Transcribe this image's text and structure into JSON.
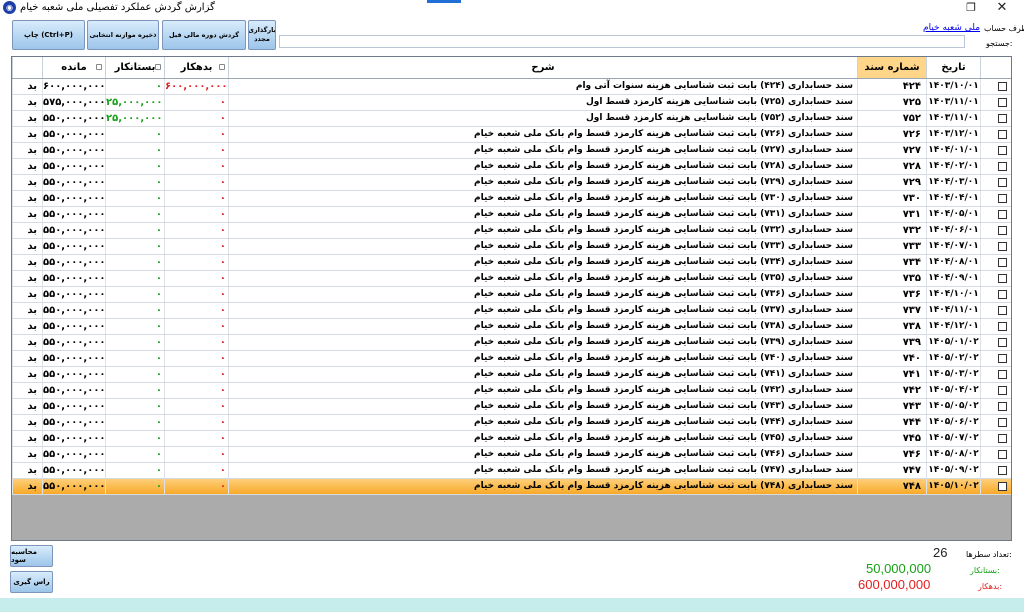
{
  "window": {
    "title": "گزارش گردش عملکرد تفصیلی  ملی شعبه خیام",
    "icon": "app-logo-icon",
    "restore_glyph": "❐",
    "close_glyph": "✕"
  },
  "toolbar": {
    "print_label": "چاپ (Ctrl+P)",
    "save_balance_label": "ذخیره موازنه انتخابی",
    "prev_turnover_label": "گردش دوره مالی قبل",
    "reload_label": "بارگذاری مجدد",
    "account_label": "طرف حساب:",
    "account_link": "ملی شعبه خیام",
    "search_label": "جستجو:",
    "search_value": "",
    "search_placeholder": ""
  },
  "grid": {
    "columns": {
      "date": "تاریخ",
      "doc_no": "شماره سند",
      "description": "شرح",
      "debit": "بدهکار",
      "credit": "بستانکار",
      "balance": "مانده"
    },
    "rows": [
      {
        "date": "۱۴۰۳/۱۰/۰۱",
        "doc_no": "۴۲۴",
        "description": "سند حسابداری (۴۲۴) بابت ثبت شناسایی هزینه سنوات آتی وام",
        "debit": "۶۰۰,۰۰۰,۰۰۰",
        "credit": "۰",
        "balance": "۶۰۰,۰۰۰,۰۰۰",
        "status": "بد"
      },
      {
        "date": "۱۴۰۳/۱۱/۰۱",
        "doc_no": "۷۲۵",
        "description": "سند حسابداری (۷۲۵) بابت شناسایی هزینه کارمزد قسط اول",
        "debit": "۰",
        "credit": "۲۵,۰۰۰,۰۰۰",
        "balance": "۵۷۵,۰۰۰,۰۰۰",
        "status": "بد"
      },
      {
        "date": "۱۴۰۳/۱۱/۰۱",
        "doc_no": "۷۵۲",
        "description": "سند حسابداری (۷۵۲) بابت شناسایی هزینه کارمزد قسط اول",
        "debit": "۰",
        "credit": "۲۵,۰۰۰,۰۰۰",
        "balance": "۵۵۰,۰۰۰,۰۰۰",
        "status": "بد"
      },
      {
        "date": "۱۴۰۳/۱۲/۰۱",
        "doc_no": "۷۲۶",
        "description": "سند حسابداری (۷۲۶) بابت ثبت شناسایی هزینه کارمزد قسط وام بانک ملی شعبه خیام",
        "debit": "۰",
        "credit": "۰",
        "balance": "۵۵۰,۰۰۰,۰۰۰",
        "status": "بد"
      },
      {
        "date": "۱۴۰۴/۰۱/۰۱",
        "doc_no": "۷۲۷",
        "description": "سند حسابداری (۷۲۷) بابت ثبت شناسایی هزینه کارمزد قسط وام بانک ملی شعبه خیام",
        "debit": "۰",
        "credit": "۰",
        "balance": "۵۵۰,۰۰۰,۰۰۰",
        "status": "بد"
      },
      {
        "date": "۱۴۰۴/۰۲/۰۱",
        "doc_no": "۷۲۸",
        "description": "سند حسابداری (۷۲۸) بابت ثبت شناسایی هزینه کارمزد قسط وام بانک ملی شعبه خیام",
        "debit": "۰",
        "credit": "۰",
        "balance": "۵۵۰,۰۰۰,۰۰۰",
        "status": "بد"
      },
      {
        "date": "۱۴۰۴/۰۳/۰۱",
        "doc_no": "۷۲۹",
        "description": "سند حسابداری (۷۲۹) بابت ثبت شناسایی هزینه کارمزد قسط وام بانک ملی شعبه خیام",
        "debit": "۰",
        "credit": "۰",
        "balance": "۵۵۰,۰۰۰,۰۰۰",
        "status": "بد"
      },
      {
        "date": "۱۴۰۴/۰۴/۰۱",
        "doc_no": "۷۳۰",
        "description": "سند حسابداری (۷۳۰) بابت ثبت شناسایی هزینه کارمزد قسط وام بانک ملی شعبه خیام",
        "debit": "۰",
        "credit": "۰",
        "balance": "۵۵۰,۰۰۰,۰۰۰",
        "status": "بد"
      },
      {
        "date": "۱۴۰۴/۰۵/۰۱",
        "doc_no": "۷۳۱",
        "description": "سند حسابداری (۷۳۱) بابت ثبت شناسایی هزینه کارمزد قسط وام بانک ملی شعبه خیام",
        "debit": "۰",
        "credit": "۰",
        "balance": "۵۵۰,۰۰۰,۰۰۰",
        "status": "بد"
      },
      {
        "date": "۱۴۰۴/۰۶/۰۱",
        "doc_no": "۷۳۲",
        "description": "سند حسابداری (۷۳۲) بابت ثبت شناسایی هزینه کارمزد قسط وام بانک ملی شعبه خیام",
        "debit": "۰",
        "credit": "۰",
        "balance": "۵۵۰,۰۰۰,۰۰۰",
        "status": "بد"
      },
      {
        "date": "۱۴۰۴/۰۷/۰۱",
        "doc_no": "۷۳۳",
        "description": "سند حسابداری (۷۳۳) بابت ثبت شناسایی هزینه کارمزد قسط وام بانک ملی شعبه خیام",
        "debit": "۰",
        "credit": "۰",
        "balance": "۵۵۰,۰۰۰,۰۰۰",
        "status": "بد"
      },
      {
        "date": "۱۴۰۴/۰۸/۰۱",
        "doc_no": "۷۳۴",
        "description": "سند حسابداری (۷۳۴) بابت ثبت شناسایی هزینه کارمزد قسط وام بانک ملی شعبه خیام",
        "debit": "۰",
        "credit": "۰",
        "balance": "۵۵۰,۰۰۰,۰۰۰",
        "status": "بد"
      },
      {
        "date": "۱۴۰۴/۰۹/۰۱",
        "doc_no": "۷۳۵",
        "description": "سند حسابداری (۷۳۵) بابت ثبت شناسایی هزینه کارمزد قسط وام بانک ملی شعبه خیام",
        "debit": "۰",
        "credit": "۰",
        "balance": "۵۵۰,۰۰۰,۰۰۰",
        "status": "بد"
      },
      {
        "date": "۱۴۰۴/۱۰/۰۱",
        "doc_no": "۷۳۶",
        "description": "سند حسابداری (۷۳۶) بابت ثبت شناسایی هزینه کارمزد قسط وام بانک ملی شعبه خیام",
        "debit": "۰",
        "credit": "۰",
        "balance": "۵۵۰,۰۰۰,۰۰۰",
        "status": "بد"
      },
      {
        "date": "۱۴۰۴/۱۱/۰۱",
        "doc_no": "۷۳۷",
        "description": "سند حسابداری (۷۳۷) بابت ثبت شناسایی هزینه کارمزد قسط وام بانک ملی شعبه خیام",
        "debit": "۰",
        "credit": "۰",
        "balance": "۵۵۰,۰۰۰,۰۰۰",
        "status": "بد"
      },
      {
        "date": "۱۴۰۴/۱۲/۰۱",
        "doc_no": "۷۳۸",
        "description": "سند حسابداری (۷۳۸) بابت ثبت شناسایی هزینه کارمزد قسط وام بانک ملی شعبه خیام",
        "debit": "۰",
        "credit": "۰",
        "balance": "۵۵۰,۰۰۰,۰۰۰",
        "status": "بد"
      },
      {
        "date": "۱۴۰۵/۰۱/۰۲",
        "doc_no": "۷۳۹",
        "description": "سند حسابداری (۷۳۹) بابت ثبت شناسایی هزینه کارمزد قسط وام بانک ملی شعبه خیام",
        "debit": "۰",
        "credit": "۰",
        "balance": "۵۵۰,۰۰۰,۰۰۰",
        "status": "بد"
      },
      {
        "date": "۱۴۰۵/۰۲/۰۲",
        "doc_no": "۷۴۰",
        "description": "سند حسابداری (۷۴۰) بابت ثبت شناسایی هزینه کارمزد قسط وام بانک ملی شعبه خیام",
        "debit": "۰",
        "credit": "۰",
        "balance": "۵۵۰,۰۰۰,۰۰۰",
        "status": "بد"
      },
      {
        "date": "۱۴۰۵/۰۳/۰۲",
        "doc_no": "۷۴۱",
        "description": "سند حسابداری (۷۴۱) بابت ثبت شناسایی هزینه کارمزد قسط وام بانک ملی شعبه خیام",
        "debit": "۰",
        "credit": "۰",
        "balance": "۵۵۰,۰۰۰,۰۰۰",
        "status": "بد"
      },
      {
        "date": "۱۴۰۵/۰۴/۰۲",
        "doc_no": "۷۴۲",
        "description": "سند حسابداری (۷۴۲) بابت ثبت شناسایی هزینه کارمزد قسط وام بانک ملی شعبه خیام",
        "debit": "۰",
        "credit": "۰",
        "balance": "۵۵۰,۰۰۰,۰۰۰",
        "status": "بد"
      },
      {
        "date": "۱۴۰۵/۰۵/۰۲",
        "doc_no": "۷۴۳",
        "description": "سند حسابداری (۷۴۳) بابت ثبت شناسایی هزینه کارمزد قسط وام بانک ملی شعبه خیام",
        "debit": "۰",
        "credit": "۰",
        "balance": "۵۵۰,۰۰۰,۰۰۰",
        "status": "بد"
      },
      {
        "date": "۱۴۰۵/۰۶/۰۲",
        "doc_no": "۷۴۴",
        "description": "سند حسابداری (۷۴۴) بابت ثبت شناسایی هزینه کارمزد قسط وام بانک ملی شعبه خیام",
        "debit": "۰",
        "credit": "۰",
        "balance": "۵۵۰,۰۰۰,۰۰۰",
        "status": "بد"
      },
      {
        "date": "۱۴۰۵/۰۷/۰۲",
        "doc_no": "۷۴۵",
        "description": "سند حسابداری (۷۴۵) بابت ثبت شناسایی هزینه کارمزد قسط وام بانک ملی شعبه خیام",
        "debit": "۰",
        "credit": "۰",
        "balance": "۵۵۰,۰۰۰,۰۰۰",
        "status": "بد"
      },
      {
        "date": "۱۴۰۵/۰۸/۰۲",
        "doc_no": "۷۴۶",
        "description": "سند حسابداری (۷۴۶) بابت ثبت شناسایی هزینه کارمزد قسط وام بانک ملی شعبه خیام",
        "debit": "۰",
        "credit": "۰",
        "balance": "۵۵۰,۰۰۰,۰۰۰",
        "status": "بد"
      },
      {
        "date": "۱۴۰۵/۰۹/۰۲",
        "doc_no": "۷۴۷",
        "description": "سند حسابداری (۷۴۷) بابت ثبت شناسایی هزینه کارمزد قسط وام بانک ملی شعبه خیام",
        "debit": "۰",
        "credit": "۰",
        "balance": "۵۵۰,۰۰۰,۰۰۰",
        "status": "بد"
      },
      {
        "date": "۱۴۰۵/۱۰/۰۲",
        "doc_no": "۷۴۸",
        "description": "سند حسابداری (۷۴۸) بابت ثبت شناسایی هزینه کارمزد قسط وام بانک ملی شعبه خیام",
        "debit": "۰",
        "credit": "۰",
        "balance": "۵۵۰,۰۰۰,۰۰۰",
        "status": "بد",
        "selected": true
      }
    ]
  },
  "footer": {
    "calc_profit_label": "محاسبه سود",
    "due_date_label": "راس گیری",
    "rows_label": "تعداد سطرها:",
    "rows_value": "26",
    "credit_label": "بستانکار:",
    "credit_value": "50,000,000",
    "debit_label": "بدهکار:",
    "debit_value": "600,000,000"
  },
  "colors": {
    "debit": "#e41f1f",
    "credit": "#17a117",
    "selected_row": "#f7a928",
    "sorted_header": "#ffd58a"
  }
}
